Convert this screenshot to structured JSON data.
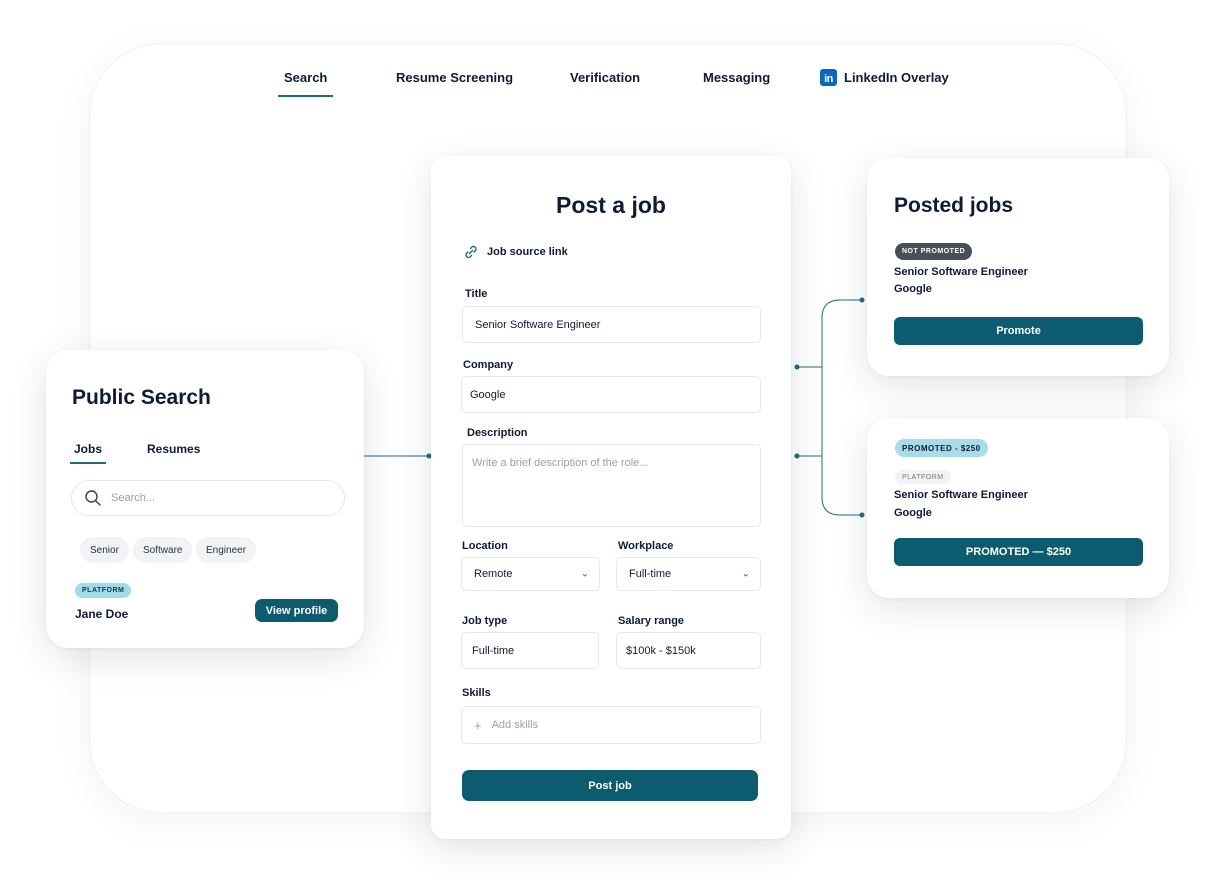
{
  "nav": {
    "tabs": [
      {
        "label": "Search",
        "active": true
      },
      {
        "label": "Resume Screening",
        "active": false
      },
      {
        "label": "Verification",
        "active": false
      },
      {
        "label": "Messaging",
        "active": false
      },
      {
        "label": "LinkedIn Overlay",
        "active": false,
        "icon": "linkedin-icon"
      }
    ],
    "linkedin_icon_text": "in"
  },
  "post_job": {
    "title": "Post a job",
    "source_link_label": "Job source link",
    "fields": {
      "title_label": "Title",
      "title_value": "Senior Software Engineer",
      "company_label": "Company",
      "company_value": "Google",
      "description_label": "Description",
      "description_placeholder": "Write a brief description of the role...",
      "location_label": "Location",
      "location_value": "Remote",
      "workplace_label": "Workplace",
      "workplace_value": "Full-time",
      "job_type_label": "Job type",
      "job_type_value": "Full-time",
      "salary_label": "Salary range",
      "salary_value": "$100k - $150k",
      "skills_label": "Skills",
      "skills_placeholder": "Add skills"
    },
    "submit_label": "Post job"
  },
  "public_search": {
    "title": "Public Search",
    "tabs": [
      {
        "label": "Jobs",
        "active": true
      },
      {
        "label": "Resumes",
        "active": false
      }
    ],
    "search_placeholder": "Search...",
    "chips": [
      "Senior",
      "Software",
      "Engineer"
    ],
    "result": {
      "badge": "PLATFORM",
      "name": "Jane Doe",
      "action_label": "View profile"
    }
  },
  "posted_jobs": {
    "title": "Posted jobs",
    "items": [
      {
        "badge": "NOT PROMOTED",
        "job_title": "Senior Software Engineer",
        "company": "Google",
        "action_label": "Promote"
      },
      {
        "badge": "PROMOTED - $250",
        "sub_badge": "PLATFORM",
        "job_title": "Senior Software Engineer",
        "company": "Google",
        "action_label": "PROMOTED — $250"
      }
    ]
  },
  "colors": {
    "primary": "#0d5b6e",
    "accent_line": "#1f6b7c",
    "platform_badge": "#9fdbe8",
    "text_dark": "#0f1a36"
  }
}
